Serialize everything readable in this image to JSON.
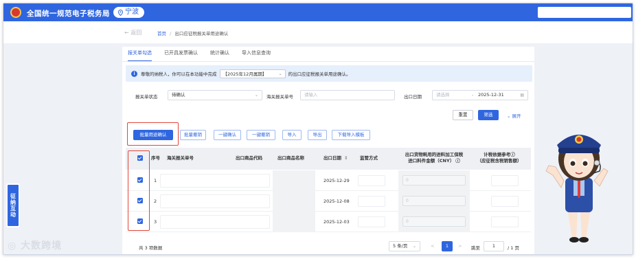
{
  "header": {
    "site_title": "全国统一规范电子税务局",
    "city": "宁波"
  },
  "nav": {
    "back": "返回",
    "breadcrumb_home": "首页",
    "breadcrumb_sep": "/",
    "breadcrumb_current": "出口应征税报关单用途确认"
  },
  "tabs": [
    {
      "label": "报关单勾选"
    },
    {
      "label": "已开具发票确认"
    },
    {
      "label": "统计确认"
    },
    {
      "label": "导入信息查询"
    }
  ],
  "notice": {
    "prefix": "尊敬的纳税人，你可以在本功能中完成",
    "period": "【2025年12月属期】",
    "suffix": "的出口应征税报关单用途确认。"
  },
  "filters": {
    "status_label": "报关单状态",
    "status_value": "待确认",
    "customs_label": "海关报关单号",
    "customs_placeholder": "请输入",
    "date_label": "出口日期",
    "date_start_placeholder": "请选择",
    "date_sep": "-",
    "date_end": "2025-12-31"
  },
  "actions": {
    "reset": "重置",
    "search": "筛选",
    "expand": "展开",
    "batch_confirm": "批量用途确认",
    "batch_cancel": "批量撤销",
    "one_click_confirm": "一键确认",
    "one_click_cancel": "一键撤销",
    "import": "导入",
    "export": "导出",
    "download_template": "下载导入模板"
  },
  "table": {
    "columns": {
      "index": "序号",
      "customs_no": "海关报关单号",
      "goods_code": "出口商品代码",
      "goods_name": "出口商品名称",
      "export_date": "出口日期",
      "supervision": "监管方式",
      "processing_amount_1": "出口货物耗用的进料加工保税",
      "processing_amount_2": "进口料件金额（CNY）",
      "tax_basis_1": "计税依据参考",
      "tax_basis_2": "（应征税含税销售额）"
    },
    "rows": [
      {
        "index": "1",
        "export_date": "2025-12-29",
        "amount": "0"
      },
      {
        "index": "2",
        "export_date": "2025-12-08",
        "amount": "0"
      },
      {
        "index": "3",
        "export_date": "2025-12-03",
        "amount": "0"
      }
    ]
  },
  "pagination": {
    "total": "共 3 项数据",
    "page_size": "5 条/页",
    "prev": "<",
    "current": "1",
    "next": ">",
    "jump_label": "跳至",
    "jump_value": "1",
    "total_pages": "/ 1 页"
  },
  "side_tab": {
    "label": "征纳互动"
  },
  "watermark": {
    "text": "大数跨境"
  },
  "colors": {
    "primary": "#2f66e0",
    "highlight": "#e0463a"
  }
}
